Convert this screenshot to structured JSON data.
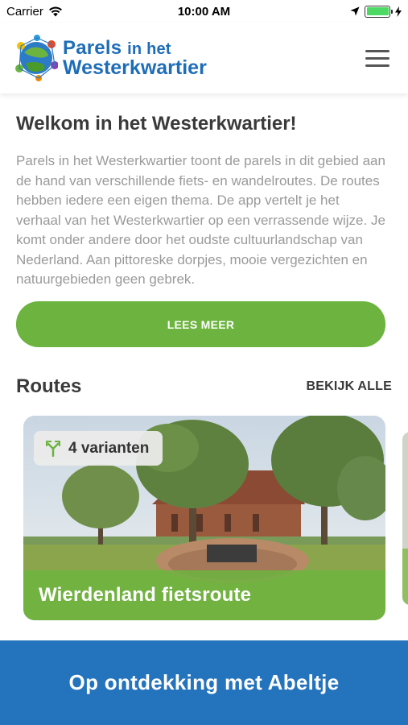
{
  "status_bar": {
    "carrier": "Carrier",
    "time": "10:00 AM"
  },
  "header": {
    "logo_line1_a": "Parels",
    "logo_line1_b": "in het",
    "logo_line2": "Westerkwartier",
    "menu_icon": "hamburger-menu-icon"
  },
  "intro": {
    "title": "Welkom in het Westerkwartier!",
    "text": "Parels in het Westerkwartier toont de parels in dit gebied aan de hand van verschillende fiets- en wandelroutes. De routes hebben iedere een eigen thema. De app vertelt je het verhaal van het Westerkwartier op een verrassende wijze. Je komt onder andere door het oudste cultuurlandschap van Nederland. Aan pittoreske dorpjes, mooie vergezichten en natuurgebieden geen gebrek.",
    "button_label": "LEES MEER"
  },
  "routes": {
    "title": "Routes",
    "view_all_label": "BEKIJK ALLE",
    "cards": [
      {
        "variants_label": "4 varianten",
        "title": "Wierdenland fietsroute",
        "icon": "route-split-icon"
      }
    ]
  },
  "banner": {
    "label": "Op ontdekking met Abeltje"
  },
  "colors": {
    "brand_green": "#6cb43f",
    "brand_blue": "#2473bd",
    "logo_blue": "#1e6db8"
  }
}
